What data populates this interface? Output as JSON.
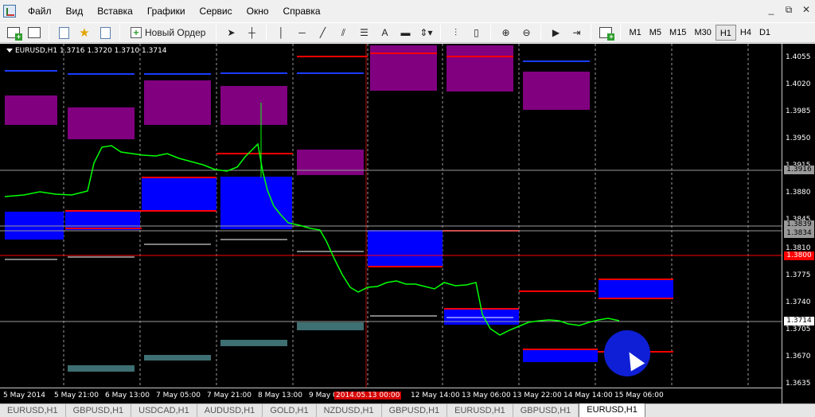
{
  "menu": {
    "items": [
      "Файл",
      "Вид",
      "Вставка",
      "Графики",
      "Сервис",
      "Окно",
      "Справка"
    ],
    "window_controls": [
      "_",
      "⧉",
      "✕"
    ]
  },
  "toolbar": {
    "new_order_label": "Новый Ордер",
    "text_tool": "A",
    "timeframes": [
      "M1",
      "M5",
      "M15",
      "M30",
      "H1",
      "H4",
      "D1"
    ],
    "active_timeframe": "H1"
  },
  "chart": {
    "symbol_header": "EURUSD,H1  1.3716 1.3720 1.3710 1.3714",
    "price_ticks": [
      "1.4055",
      "1.4020",
      "1.3985",
      "1.3950",
      "1.3915",
      "1.3880",
      "1.3845",
      "1.3810",
      "1.3775",
      "1.3740",
      "1.3705",
      "1.3670",
      "1.3635"
    ],
    "time_labels": [
      "5 May 2014",
      "5 May 21:00",
      "6 May 13:00",
      "7 May 05:00",
      "7 May 21:00",
      "8 May 13:00",
      "9 May 0",
      "2014.05.13 00:00",
      "12 May 14:00",
      "13 May 06:00",
      "13 May 22:00",
      "14 May 14:00",
      "15 May 06:00"
    ],
    "tag_high": "1.3916",
    "tag_mid1": "1.3839",
    "tag_mid2": "1.3834",
    "tag_red": "1.3800",
    "tag_current": "1.3714",
    "colors": {
      "background": "#000000",
      "candles": "#00ff00",
      "purple_zone": "#800080",
      "blue_zone": "#0000ff",
      "red_level": "#ff0000"
    }
  },
  "tabs": {
    "items": [
      "EURUSD,H1",
      "GBPUSD,H1",
      "USDCAD,H1",
      "AUDUSD,H1",
      "GOLD,H1",
      "NZDUSD,H1",
      "GBPUSD,H1",
      "EURUSD,H1",
      "GBPUSD,H1",
      "EURUSD,H1"
    ],
    "active": "EURUSD,H1"
  }
}
